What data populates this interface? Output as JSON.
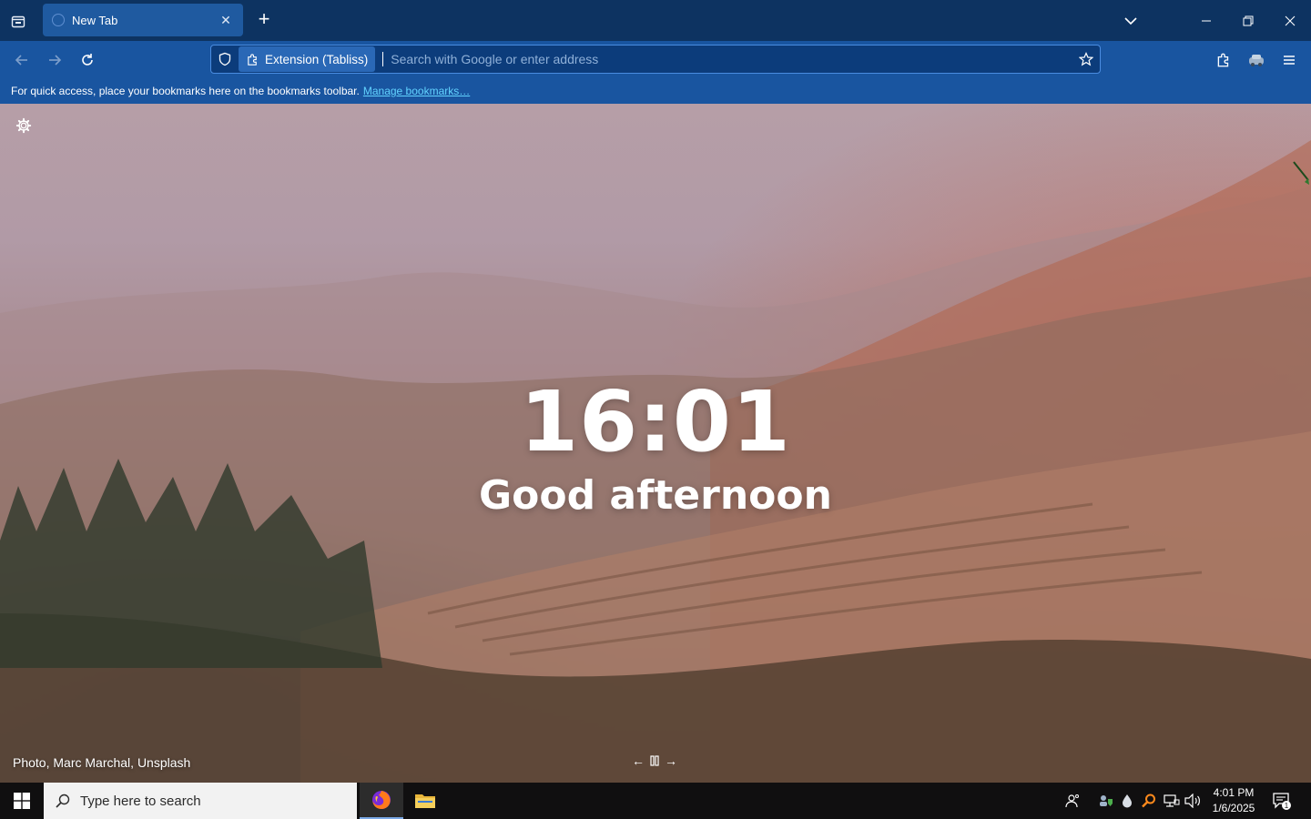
{
  "browser": {
    "tab": {
      "title": "New Tab",
      "close_symbol": "✕"
    },
    "new_tab_symbol": "+",
    "urlbar": {
      "identity_label": "Extension (Tabliss)",
      "placeholder": "Search with Google or enter address",
      "value": ""
    },
    "bookmarks_bar": {
      "message": "For quick access, place your bookmarks here on the bookmarks toolbar.",
      "link_label": "Manage bookmarks…"
    },
    "accent_color": "#1955a0",
    "link_color": "#62d3ff"
  },
  "tabliss": {
    "time": "16:01",
    "greeting": "Good afternoon",
    "photo_credit": "Photo, Marc Marchal, Unsplash",
    "controls": {
      "prev": "←",
      "pause": "⏸",
      "next": "→"
    }
  },
  "taskbar": {
    "search_placeholder": "Type here to search",
    "clock_time": "4:01 PM",
    "clock_date": "1/6/2025",
    "notification_count": "1"
  }
}
